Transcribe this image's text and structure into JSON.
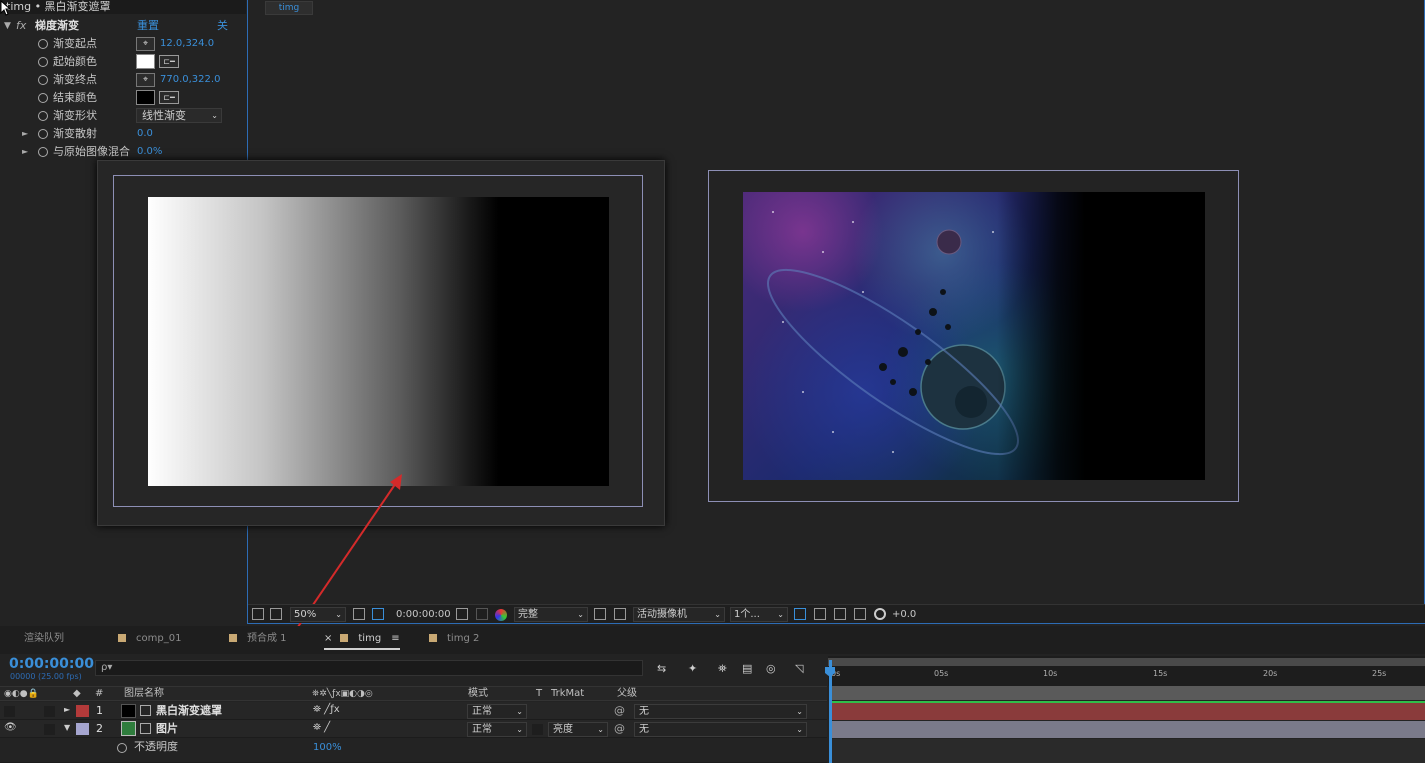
{
  "effects_panel": {
    "title": "timg • 黑白渐变遮罩",
    "effect": {
      "fx_label": "fx",
      "name": "梯度渐变",
      "reset": "重置",
      "off": "关"
    },
    "params": [
      {
        "label": "渐变起点",
        "value": "12.0,324.0",
        "kind": "point"
      },
      {
        "label": "起始颜色",
        "value": "",
        "kind": "color",
        "color": "#ffffff"
      },
      {
        "label": "渐变终点",
        "value": "770.0,322.0",
        "kind": "point"
      },
      {
        "label": "结束颜色",
        "value": "",
        "kind": "color",
        "color": "#000000"
      },
      {
        "label": "渐变形状",
        "value": "线性渐变",
        "kind": "select"
      },
      {
        "label": "渐变散射",
        "value": "0.0",
        "kind": "number"
      },
      {
        "label": "与原始图像混合",
        "value": "0.0%",
        "kind": "number"
      }
    ]
  },
  "viewer": {
    "tab": "timg",
    "toolbar": {
      "zoom": "50%",
      "timecode": "0:00:00:00",
      "resolution": "完整",
      "camera": "活动摄像机",
      "views": "1个...",
      "exposure": "+0.0"
    }
  },
  "panel_tabs": [
    {
      "label": "渲染队列",
      "active": false,
      "swatch": false
    },
    {
      "label": "comp_01",
      "active": false,
      "swatch": true
    },
    {
      "label": "预合成 1",
      "active": false,
      "swatch": true
    },
    {
      "label": "timg",
      "active": true,
      "swatch": true
    },
    {
      "label": "timg 2",
      "active": false,
      "swatch": true
    }
  ],
  "timeline": {
    "timecode": "0:00:00:00",
    "fps": "00000 (25.00 fps)",
    "search_placeholder": "ρ▾",
    "headers": {
      "num": "#",
      "layer_name": "图层名称",
      "mode": "模式",
      "t": "T",
      "trkmat": "TrkMat",
      "parent": "父级"
    },
    "layers": [
      {
        "num": "1",
        "name": "黑白渐变遮罩",
        "mode": "正常",
        "trkmat": "",
        "parent": "无",
        "label_color": "#b33a3a"
      },
      {
        "num": "2",
        "name": "图片",
        "mode": "正常",
        "trkmat": "亮度",
        "parent": "无",
        "label_color": "#a5a5cf"
      }
    ],
    "sub_property": {
      "label": "不透明度",
      "value": "100%"
    },
    "ruler_ticks": [
      "0s",
      "05s",
      "10s",
      "15s",
      "20s",
      "25s"
    ]
  }
}
